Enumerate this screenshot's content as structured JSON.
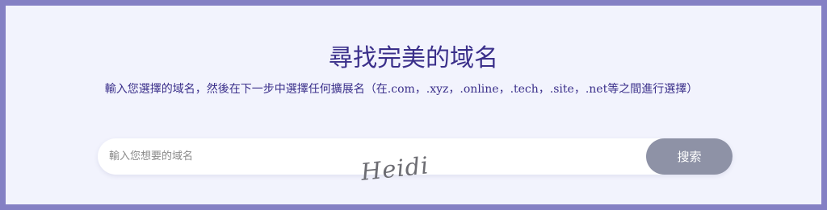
{
  "header": {
    "title": "尋找完美的域名",
    "subtitle": "輸入您選擇的域名，然後在下一步中選擇任何擴展名（在.com，.xyz，.online，.tech，.site，.net等之間進行選擇）"
  },
  "search": {
    "placeholder": "輸入您想要的域名",
    "value": "",
    "button_label": "搜索"
  },
  "watermark": {
    "text": "Heidi"
  },
  "colors": {
    "frame": "#8480c4",
    "panel_background": "#f2f3fd",
    "heading_text": "#3a2f8a",
    "button_background": "#8e92a6"
  }
}
